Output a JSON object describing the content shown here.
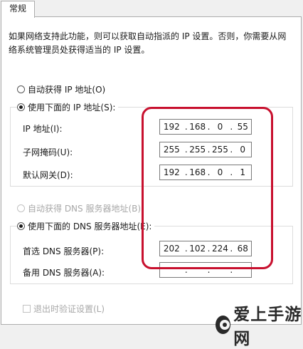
{
  "tab": {
    "label": "常规"
  },
  "description": "如果网络支持此功能，则可以获取自动指派的 IP 设置。否则，你需要从网络系统管理员处获得适当的 IP 设置。",
  "ip_mode": {
    "auto_label": "自动获得 IP 地址(O)",
    "manual_label": "使用下面的 IP 地址(S):",
    "selected": "manual"
  },
  "ip_fields": {
    "ip_label": "IP 地址(I):",
    "ip_value": [
      "192",
      "168",
      "0",
      "55"
    ],
    "mask_label": "子网掩码(U):",
    "mask_value": [
      "255",
      "255",
      "255",
      "0"
    ],
    "gateway_label": "默认网关(D):",
    "gateway_value": [
      "192",
      "168",
      "0",
      "1"
    ]
  },
  "dns_mode": {
    "auto_label": "自动获得 DNS 服务器地址(B)",
    "manual_label": "使用下面的 DNS 服务器地址(E):",
    "selected": "manual"
  },
  "dns_fields": {
    "preferred_label": "首选 DNS 服务器(P):",
    "preferred_value": [
      "202",
      "102",
      "224",
      "68"
    ],
    "alternate_label": "备用 DNS 服务器(A):",
    "alternate_value": [
      "",
      "",
      "",
      ""
    ]
  },
  "validate": {
    "label": "退出时验证设置(L)",
    "checked": false
  },
  "watermark": {
    "text": "爱上手游网"
  },
  "colors": {
    "highlight": "#c8102e",
    "border": "#7a7a7a"
  }
}
